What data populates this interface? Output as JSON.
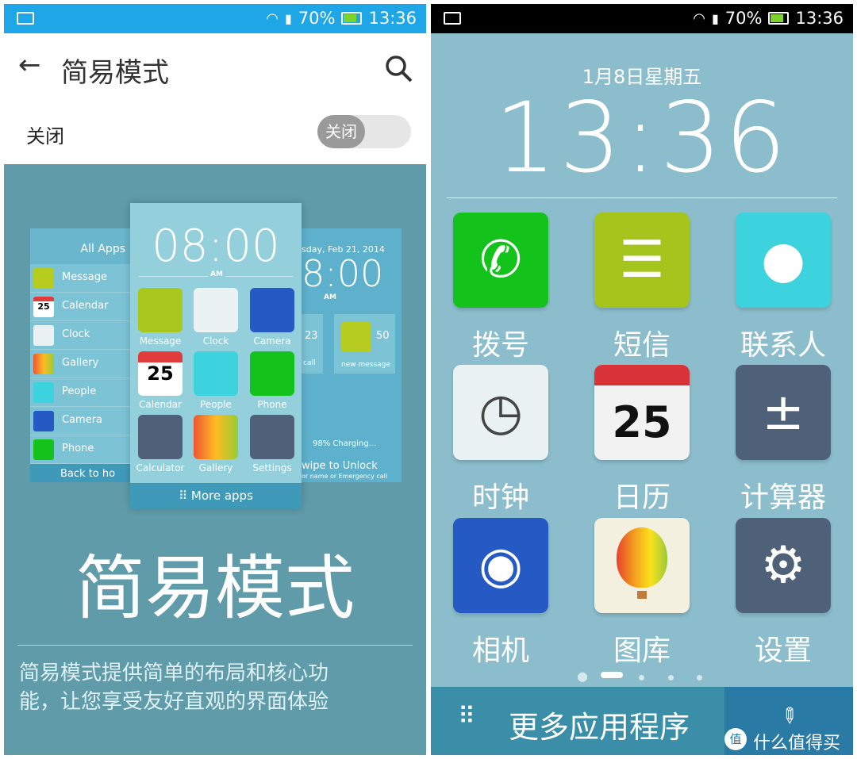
{
  "status": {
    "battery": "70%",
    "time": "13:36"
  },
  "left": {
    "header": {
      "title": "简易模式"
    },
    "toggle_row": {
      "label": "关闭",
      "toggle_text": "关闭",
      "state": "off"
    },
    "preview": {
      "all_apps_title": "All Apps",
      "list": [
        "Message",
        "Calendar",
        "Clock",
        "Gallery",
        "People",
        "Camera",
        "Phone"
      ],
      "calendar_day": "25",
      "back_home": "Back to ho",
      "clock": "08:00",
      "ampm": "AM",
      "grid": [
        "Message",
        "Clock",
        "Camera",
        "Calendar",
        "People",
        "Phone",
        "Calculator",
        "Gallery",
        "Settings"
      ],
      "more_apps": "More apps",
      "lock_date": "sday, Feb 21, 2014",
      "lock_clock": "8:00",
      "lock_ampm": "AM",
      "missed_count": "23",
      "missed_label": "call",
      "msg_count": "50",
      "msg_label": "new message",
      "charging": "98% Charging...",
      "unlock": "wipe to Unlock",
      "unlock_sub": "or name or Emergency call"
    },
    "big_title": "简易模式",
    "description_lines": [
      "简易模式提供简单的布局和核心功",
      "能，让您享受友好直观的界面体验"
    ]
  },
  "right": {
    "date": "1月8日星期五",
    "clock": "13:36",
    "apps": [
      {
        "label": "拨号",
        "icon": "phone-icon",
        "color": "#14c21c"
      },
      {
        "label": "短信",
        "icon": "message-icon",
        "color": "#a5c41c"
      },
      {
        "label": "联系人",
        "icon": "contacts-icon",
        "color": "#3cd3de"
      },
      {
        "label": "时钟",
        "icon": "clock-icon",
        "color": "#e9f1f3"
      },
      {
        "label": "日历",
        "icon": "calendar-icon",
        "color": "#f2f2f2"
      },
      {
        "label": "计算器",
        "icon": "calculator-icon",
        "color": "#4f6079"
      },
      {
        "label": "相机",
        "icon": "camera-icon",
        "color": "#2559c3"
      },
      {
        "label": "图库",
        "icon": "gallery-icon",
        "color": "#f4f0e0"
      },
      {
        "label": "设置",
        "icon": "settings-icon",
        "color": "#4f6079"
      }
    ],
    "calendar_day": "25",
    "more_apps": "更多应用程序",
    "watermark": "什么值得买"
  }
}
